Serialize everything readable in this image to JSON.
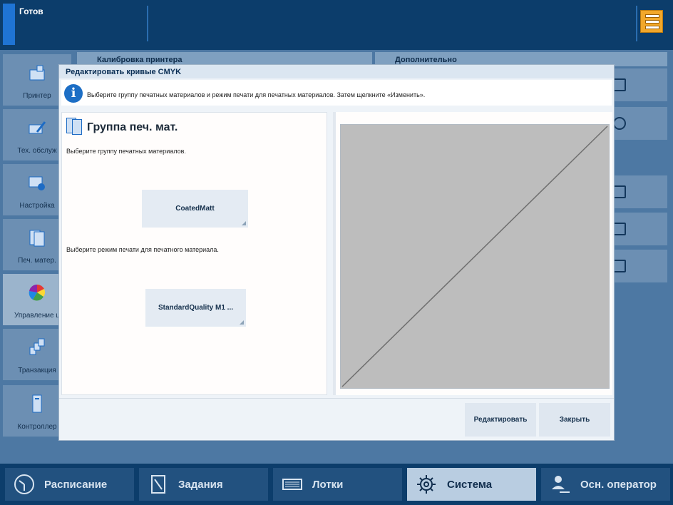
{
  "status": {
    "text": "Готов"
  },
  "left_nav": [
    {
      "label": "Принтер",
      "icon": "printer-icon"
    },
    {
      "label": "Тех. обслуж",
      "icon": "maintenance-icon"
    },
    {
      "label": "Настройка",
      "icon": "configuration-icon"
    },
    {
      "label": "Печ. матер.",
      "icon": "media-icon"
    },
    {
      "label": "Управление ц",
      "icon": "color-management-icon"
    },
    {
      "label": "Транзакция",
      "icon": "transaction-icon"
    },
    {
      "label": "Контроллер",
      "icon": "controller-icon"
    }
  ],
  "background_panels": {
    "calibration_title": "Калибровка принтера",
    "extra_title": "Дополнительно"
  },
  "dialog": {
    "title": "Редактировать кривые CMYK",
    "info": "Выберите группу печатных материалов и режим печати для печатных материалов. Затем щелкните «Изменить».",
    "section_title": "Группа печ. мат.",
    "media_group_prompt": "Выберите группу печатных материалов.",
    "media_group_value": "CoatedMatt",
    "print_mode_prompt": "Выберите режим печати для печатного материала.",
    "print_mode_value": "StandardQuality M1 ...",
    "edit_button": "Редактировать",
    "close_button": "Закрыть"
  },
  "bottom_nav": [
    {
      "label": "Расписание",
      "icon": "clock-icon",
      "active": false
    },
    {
      "label": "Задания",
      "icon": "jobs-icon",
      "active": false
    },
    {
      "label": "Лотки",
      "icon": "trays-icon",
      "active": false
    },
    {
      "label": "Система",
      "icon": "gear-icon",
      "active": true
    },
    {
      "label": "Осн. оператор",
      "icon": "user-key-icon",
      "active": false
    }
  ],
  "colors": {
    "accent": "#1f74d4",
    "menu_button": "#f2a72a",
    "curve_background": "#bdbdbd"
  }
}
